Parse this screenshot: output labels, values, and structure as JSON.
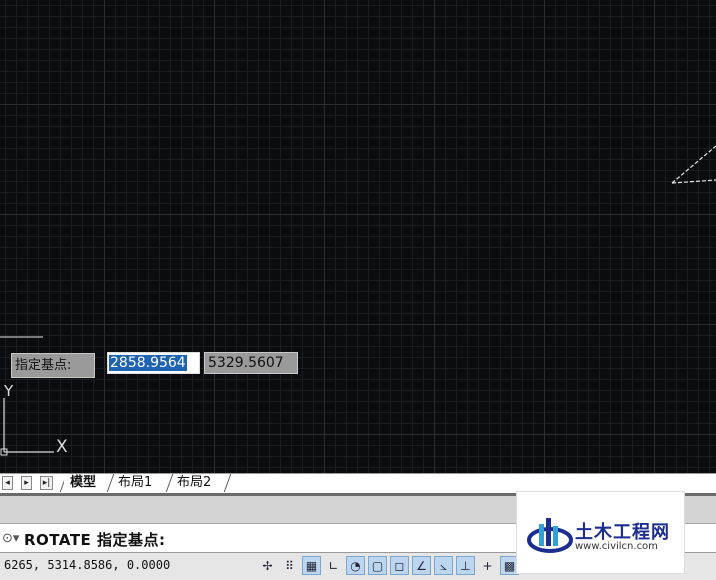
{
  "canvas": {
    "prompt_label": "指定基点:",
    "coord_x": "2858.9564",
    "coord_y": "5329.5607",
    "ucs_x_label": "X",
    "ucs_y_label": "Y",
    "grid_color": "#2a2f36",
    "background_color": "#0a0c0f"
  },
  "tabs": {
    "nav_first": "◂",
    "nav_prev": "▸",
    "nav_last": "▸|",
    "items": [
      "模型",
      "布局1",
      "布局2"
    ],
    "active": "模型"
  },
  "command_line": {
    "icon": "command-history-icon",
    "text": "ROTATE 指定基点:"
  },
  "status_bar": {
    "coordinates": "6265, 5314.8586, 0.0000",
    "tools": [
      {
        "name": "infer-constraints-icon",
        "glyph": "✢",
        "on": false
      },
      {
        "name": "snap-mode-icon",
        "glyph": "⠿",
        "on": false
      },
      {
        "name": "grid-display-icon",
        "glyph": "▦",
        "on": true
      },
      {
        "name": "ortho-mode-icon",
        "glyph": "∟",
        "on": false
      },
      {
        "name": "polar-tracking-icon",
        "glyph": "◔",
        "on": true
      },
      {
        "name": "object-snap-icon",
        "glyph": "▢",
        "on": true
      },
      {
        "name": "3d-object-snap-icon",
        "glyph": "◻",
        "on": true
      },
      {
        "name": "object-snap-tracking-icon",
        "glyph": "∠",
        "on": true
      },
      {
        "name": "dynamic-ucs-icon",
        "glyph": "⦣",
        "on": true
      },
      {
        "name": "dynamic-input-icon",
        "glyph": "⊥",
        "on": true
      },
      {
        "name": "lineweight-icon",
        "glyph": "+",
        "on": false
      },
      {
        "name": "transparency-icon",
        "glyph": "▩",
        "on": true
      }
    ]
  },
  "watermark": {
    "title": "土木工程网",
    "url": "www.civilcn.com",
    "brand_color": "#1b2d8e"
  }
}
